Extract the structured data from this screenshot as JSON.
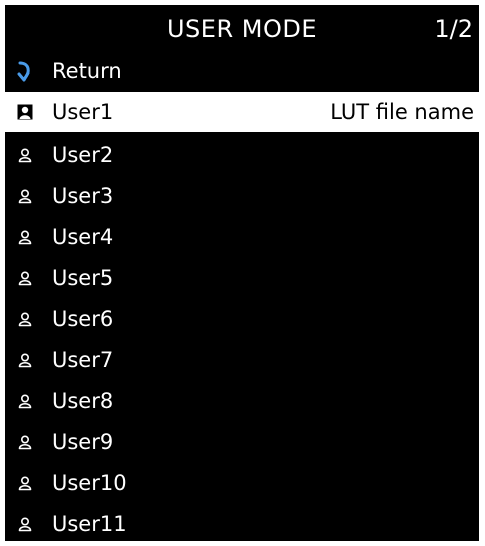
{
  "header": {
    "title": "USER MODE",
    "page": "1/2"
  },
  "menu": {
    "return": {
      "label": "Return",
      "icon": "return-arrow-icon"
    },
    "items": [
      {
        "label": "User1",
        "value": "LUT file name",
        "selected": true,
        "icon": "user-icon"
      },
      {
        "label": "User2",
        "icon": "user-icon"
      },
      {
        "label": "User3",
        "icon": "user-icon"
      },
      {
        "label": "User4",
        "icon": "user-icon"
      },
      {
        "label": "User5",
        "icon": "user-icon"
      },
      {
        "label": "User6",
        "icon": "user-icon"
      },
      {
        "label": "User7",
        "icon": "user-icon"
      },
      {
        "label": "User8",
        "icon": "user-icon"
      },
      {
        "label": "User9",
        "icon": "user-icon"
      },
      {
        "label": "User10",
        "icon": "user-icon"
      },
      {
        "label": "User11",
        "icon": "user-icon"
      }
    ]
  },
  "colors": {
    "background": "#000000",
    "text": "#ffffff",
    "highlight": "#ffffff",
    "return_icon": "#4a9be8"
  }
}
